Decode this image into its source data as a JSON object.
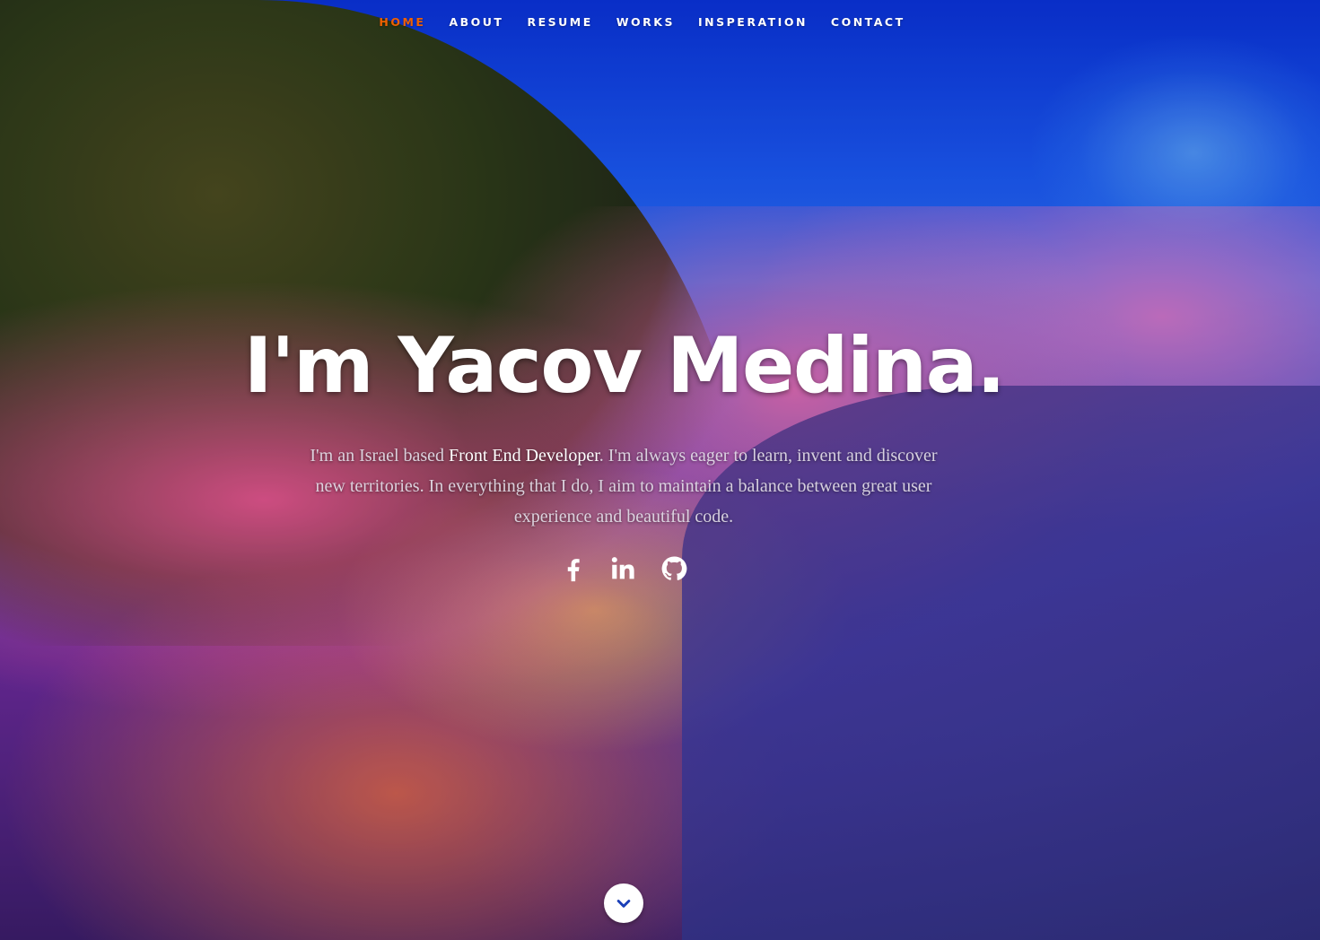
{
  "nav": {
    "items": [
      {
        "label": "HOME",
        "active": true
      },
      {
        "label": "ABOUT",
        "active": false
      },
      {
        "label": "RESUME",
        "active": false
      },
      {
        "label": "WORKS",
        "active": false
      },
      {
        "label": "INSPERATION",
        "active": false
      },
      {
        "label": "CONTACT",
        "active": false
      }
    ],
    "active_color": "#F06000"
  },
  "hero": {
    "headline": "I'm Yacov Medina.",
    "bio_before": "I'm an Israel based ",
    "bio_strong": "Front End Developer",
    "bio_after": ". I'm always eager to learn, invent and discover new territories. In everything that I do, I aim to maintain a balance between great user experience and beautiful code."
  },
  "social": {
    "icons": [
      "facebook-icon",
      "linkedin-icon",
      "github-icon"
    ]
  },
  "scroll": {
    "icon": "chevron-down-icon"
  }
}
